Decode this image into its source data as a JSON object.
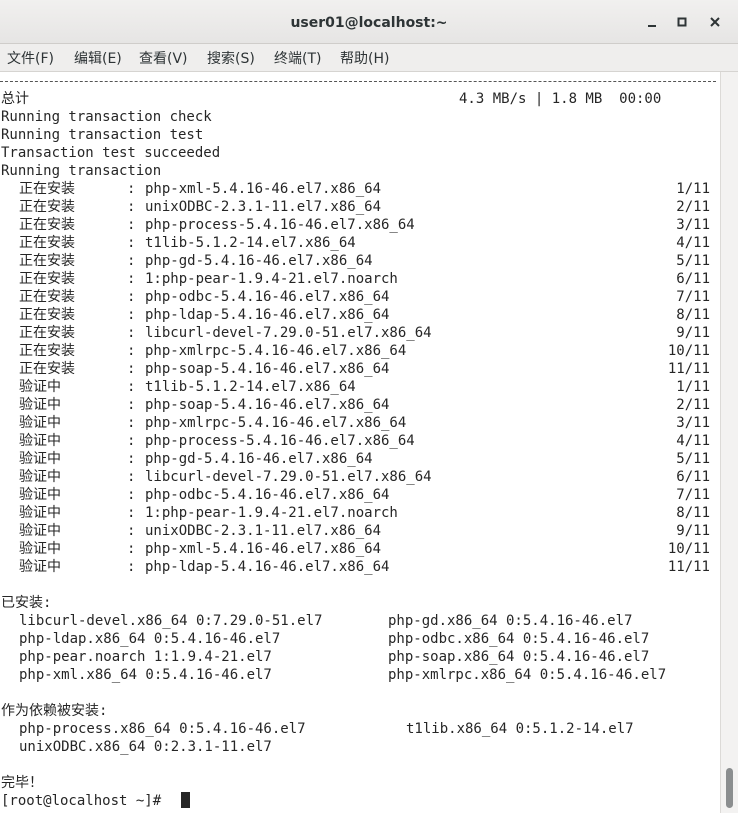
{
  "window": {
    "title": "user01@localhost:~",
    "minimize_icon": "minimize-icon",
    "maximize_icon": "maximize-icon",
    "close_icon": "close-icon"
  },
  "menu": [
    {
      "label": "文件(F)"
    },
    {
      "label": "编辑(E)"
    },
    {
      "label": "查看(V)"
    },
    {
      "label": "搜索(S)"
    },
    {
      "label": "终端(T)"
    },
    {
      "label": "帮助(H)"
    }
  ],
  "terminal": {
    "summary": {
      "total_label": "总计",
      "total_stats": "4.3 MB/s | 1.8 MB  00:00"
    },
    "messages": [
      "Running transaction check",
      "Running transaction test",
      "Transaction test succeeded",
      "Running transaction"
    ],
    "steps": [
      {
        "action": "正在安装",
        "package": "php-xml-5.4.16-46.el7.x86_64",
        "progress": "1/11"
      },
      {
        "action": "正在安装",
        "package": "unixODBC-2.3.1-11.el7.x86_64",
        "progress": "2/11"
      },
      {
        "action": "正在安装",
        "package": "php-process-5.4.16-46.el7.x86_64",
        "progress": "3/11"
      },
      {
        "action": "正在安装",
        "package": "t1lib-5.1.2-14.el7.x86_64",
        "progress": "4/11"
      },
      {
        "action": "正在安装",
        "package": "php-gd-5.4.16-46.el7.x86_64",
        "progress": "5/11"
      },
      {
        "action": "正在安装",
        "package": "1:php-pear-1.9.4-21.el7.noarch",
        "progress": "6/11"
      },
      {
        "action": "正在安装",
        "package": "php-odbc-5.4.16-46.el7.x86_64",
        "progress": "7/11"
      },
      {
        "action": "正在安装",
        "package": "php-ldap-5.4.16-46.el7.x86_64",
        "progress": "8/11"
      },
      {
        "action": "正在安装",
        "package": "libcurl-devel-7.29.0-51.el7.x86_64",
        "progress": "9/11"
      },
      {
        "action": "正在安装",
        "package": "php-xmlrpc-5.4.16-46.el7.x86_64",
        "progress": "10/11"
      },
      {
        "action": "正在安装",
        "package": "php-soap-5.4.16-46.el7.x86_64",
        "progress": "11/11"
      },
      {
        "action": "验证中",
        "package": "t1lib-5.1.2-14.el7.x86_64",
        "progress": "1/11"
      },
      {
        "action": "验证中",
        "package": "php-soap-5.4.16-46.el7.x86_64",
        "progress": "2/11"
      },
      {
        "action": "验证中",
        "package": "php-xmlrpc-5.4.16-46.el7.x86_64",
        "progress": "3/11"
      },
      {
        "action": "验证中",
        "package": "php-process-5.4.16-46.el7.x86_64",
        "progress": "4/11"
      },
      {
        "action": "验证中",
        "package": "php-gd-5.4.16-46.el7.x86_64",
        "progress": "5/11"
      },
      {
        "action": "验证中",
        "package": "libcurl-devel-7.29.0-51.el7.x86_64",
        "progress": "6/11"
      },
      {
        "action": "验证中",
        "package": "php-odbc-5.4.16-46.el7.x86_64",
        "progress": "7/11"
      },
      {
        "action": "验证中",
        "package": "1:php-pear-1.9.4-21.el7.noarch",
        "progress": "8/11"
      },
      {
        "action": "验证中",
        "package": "unixODBC-2.3.1-11.el7.x86_64",
        "progress": "9/11"
      },
      {
        "action": "验证中",
        "package": "php-xml-5.4.16-46.el7.x86_64",
        "progress": "10/11"
      },
      {
        "action": "验证中",
        "package": "php-ldap-5.4.16-46.el7.x86_64",
        "progress": "11/11"
      }
    ],
    "installed_heading": "已安装:",
    "installed": [
      [
        "libcurl-devel.x86_64 0:7.29.0-51.el7",
        "php-gd.x86_64 0:5.4.16-46.el7"
      ],
      [
        "php-ldap.x86_64 0:5.4.16-46.el7",
        "php-odbc.x86_64 0:5.4.16-46.el7"
      ],
      [
        "php-pear.noarch 1:1.9.4-21.el7",
        "php-soap.x86_64 0:5.4.16-46.el7"
      ],
      [
        "php-xml.x86_64 0:5.4.16-46.el7",
        "php-xmlrpc.x86_64 0:5.4.16-46.el7"
      ]
    ],
    "dependency_heading": "作为依赖被安装:",
    "dependencies": [
      [
        "php-process.x86_64 0:5.4.16-46.el7",
        "t1lib.x86_64 0:5.1.2-14.el7"
      ],
      [
        "unixODBC.x86_64 0:2.3.1-11.el7",
        ""
      ]
    ],
    "complete": "完毕！",
    "prompt": "[root@localhost ~]# "
  }
}
